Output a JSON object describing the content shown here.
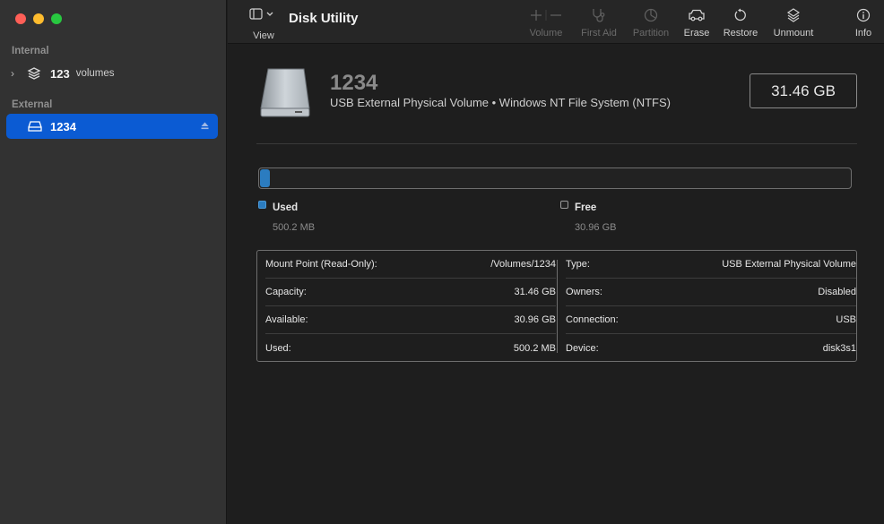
{
  "app": {
    "title": "Disk Utility"
  },
  "toolbar": {
    "view_label": "View",
    "buttons": [
      {
        "label": "Volume",
        "icon": "plus-minus-icon",
        "enabled": false
      },
      {
        "label": "First Aid",
        "icon": "stethoscope-icon",
        "enabled": false
      },
      {
        "label": "Partition",
        "icon": "pie-icon",
        "enabled": false
      },
      {
        "label": "Erase",
        "icon": "car-erase-icon",
        "enabled": true
      },
      {
        "label": "Restore",
        "icon": "restore-icon",
        "enabled": true
      },
      {
        "label": "Unmount",
        "icon": "unmount-icon",
        "enabled": true
      },
      {
        "label": "Info",
        "icon": "info-icon",
        "enabled": true
      }
    ]
  },
  "sidebar": {
    "internal_header": "Internal",
    "internal_item": {
      "name": "123",
      "sub": "volumes"
    },
    "external_header": "External",
    "external_item": {
      "name": "1234"
    }
  },
  "disk": {
    "name": "1234",
    "description": "USB External Physical Volume • Windows NT File System (NTFS)",
    "capacity": "31.46 GB",
    "used_fraction": 0.016
  },
  "usage": {
    "used_label": "Used",
    "used_value": "500.2 MB",
    "free_label": "Free",
    "free_value": "30.96 GB",
    "used_color": "#2b7cc0"
  },
  "info": {
    "left": [
      {
        "key": "Mount Point (Read-Only):",
        "value": "/Volumes/1234"
      },
      {
        "key": "Capacity:",
        "value": "31.46 GB"
      },
      {
        "key": "Available:",
        "value": "30.96 GB"
      },
      {
        "key": "Used:",
        "value": "500.2 MB"
      }
    ],
    "right": [
      {
        "key": "Type:",
        "value": "USB External Physical Volume"
      },
      {
        "key": "Owners:",
        "value": "Disabled"
      },
      {
        "key": "Connection:",
        "value": "USB"
      },
      {
        "key": "Device:",
        "value": "disk3s1"
      }
    ]
  }
}
